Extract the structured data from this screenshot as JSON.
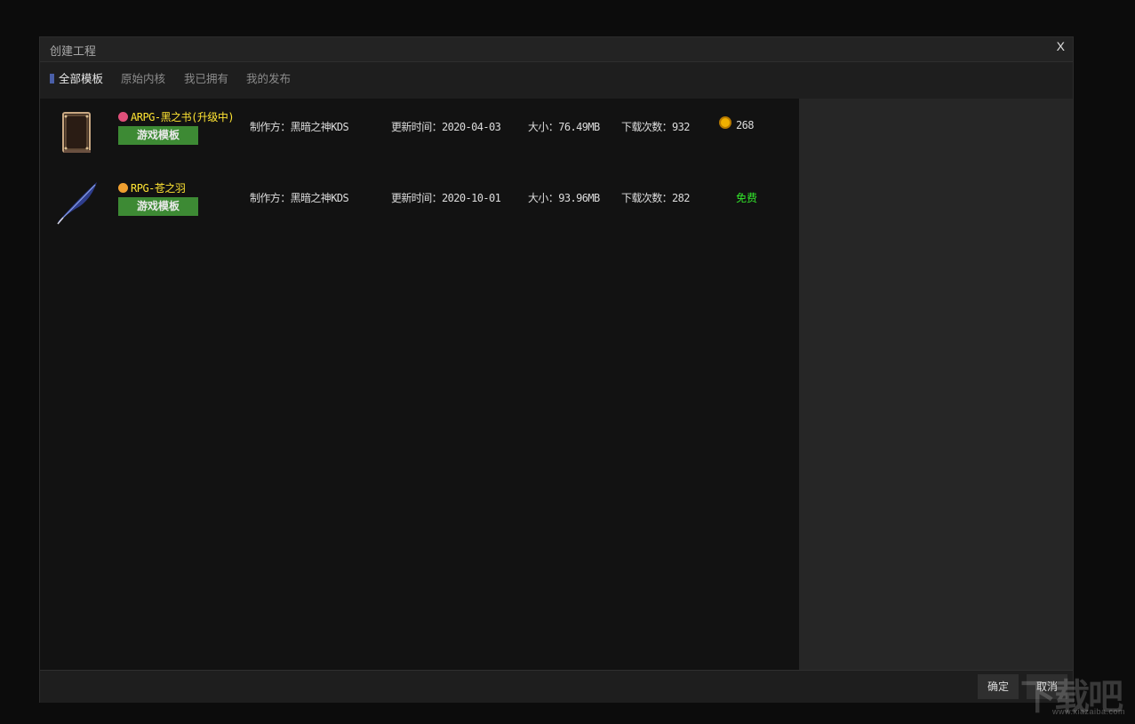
{
  "window": {
    "title": "创建工程",
    "close_label": "X"
  },
  "tabs": [
    {
      "label": "全部模板",
      "active": true
    },
    {
      "label": "原始内核",
      "active": false
    },
    {
      "label": "我已拥有",
      "active": false
    },
    {
      "label": "我的发布",
      "active": false
    }
  ],
  "templates": [
    {
      "name": "ARPG-黑之书(升级中)",
      "tag": "游戏模板",
      "author": "制作方：黑暗之神KDS",
      "updated": "更新时间：2020-04-03",
      "size": "大小：76.49MB",
      "downloads": "下载次数：932",
      "price": "268",
      "icon": "book-icon",
      "gem_color": "#e0507a"
    },
    {
      "name": "RPG-苍之羽",
      "tag": "游戏模板",
      "author": "制作方：黑暗之神KDS",
      "updated": "更新时间：2020-10-01",
      "size": "大小：93.96MB",
      "downloads": "下载次数：282",
      "price": "免费",
      "icon": "feather-icon",
      "gem_color": "#f0a030"
    }
  ],
  "footer": {
    "confirm_label": "确定",
    "cancel_label": "取消"
  },
  "watermark": {
    "text": "下载吧",
    "url": "www.xiazaiba.com"
  },
  "colors": {
    "accent_tag": "#3d8a34",
    "name_yellow": "#ffe433",
    "free_green": "#33e52b",
    "tab_marker": "#4a5fa8"
  }
}
